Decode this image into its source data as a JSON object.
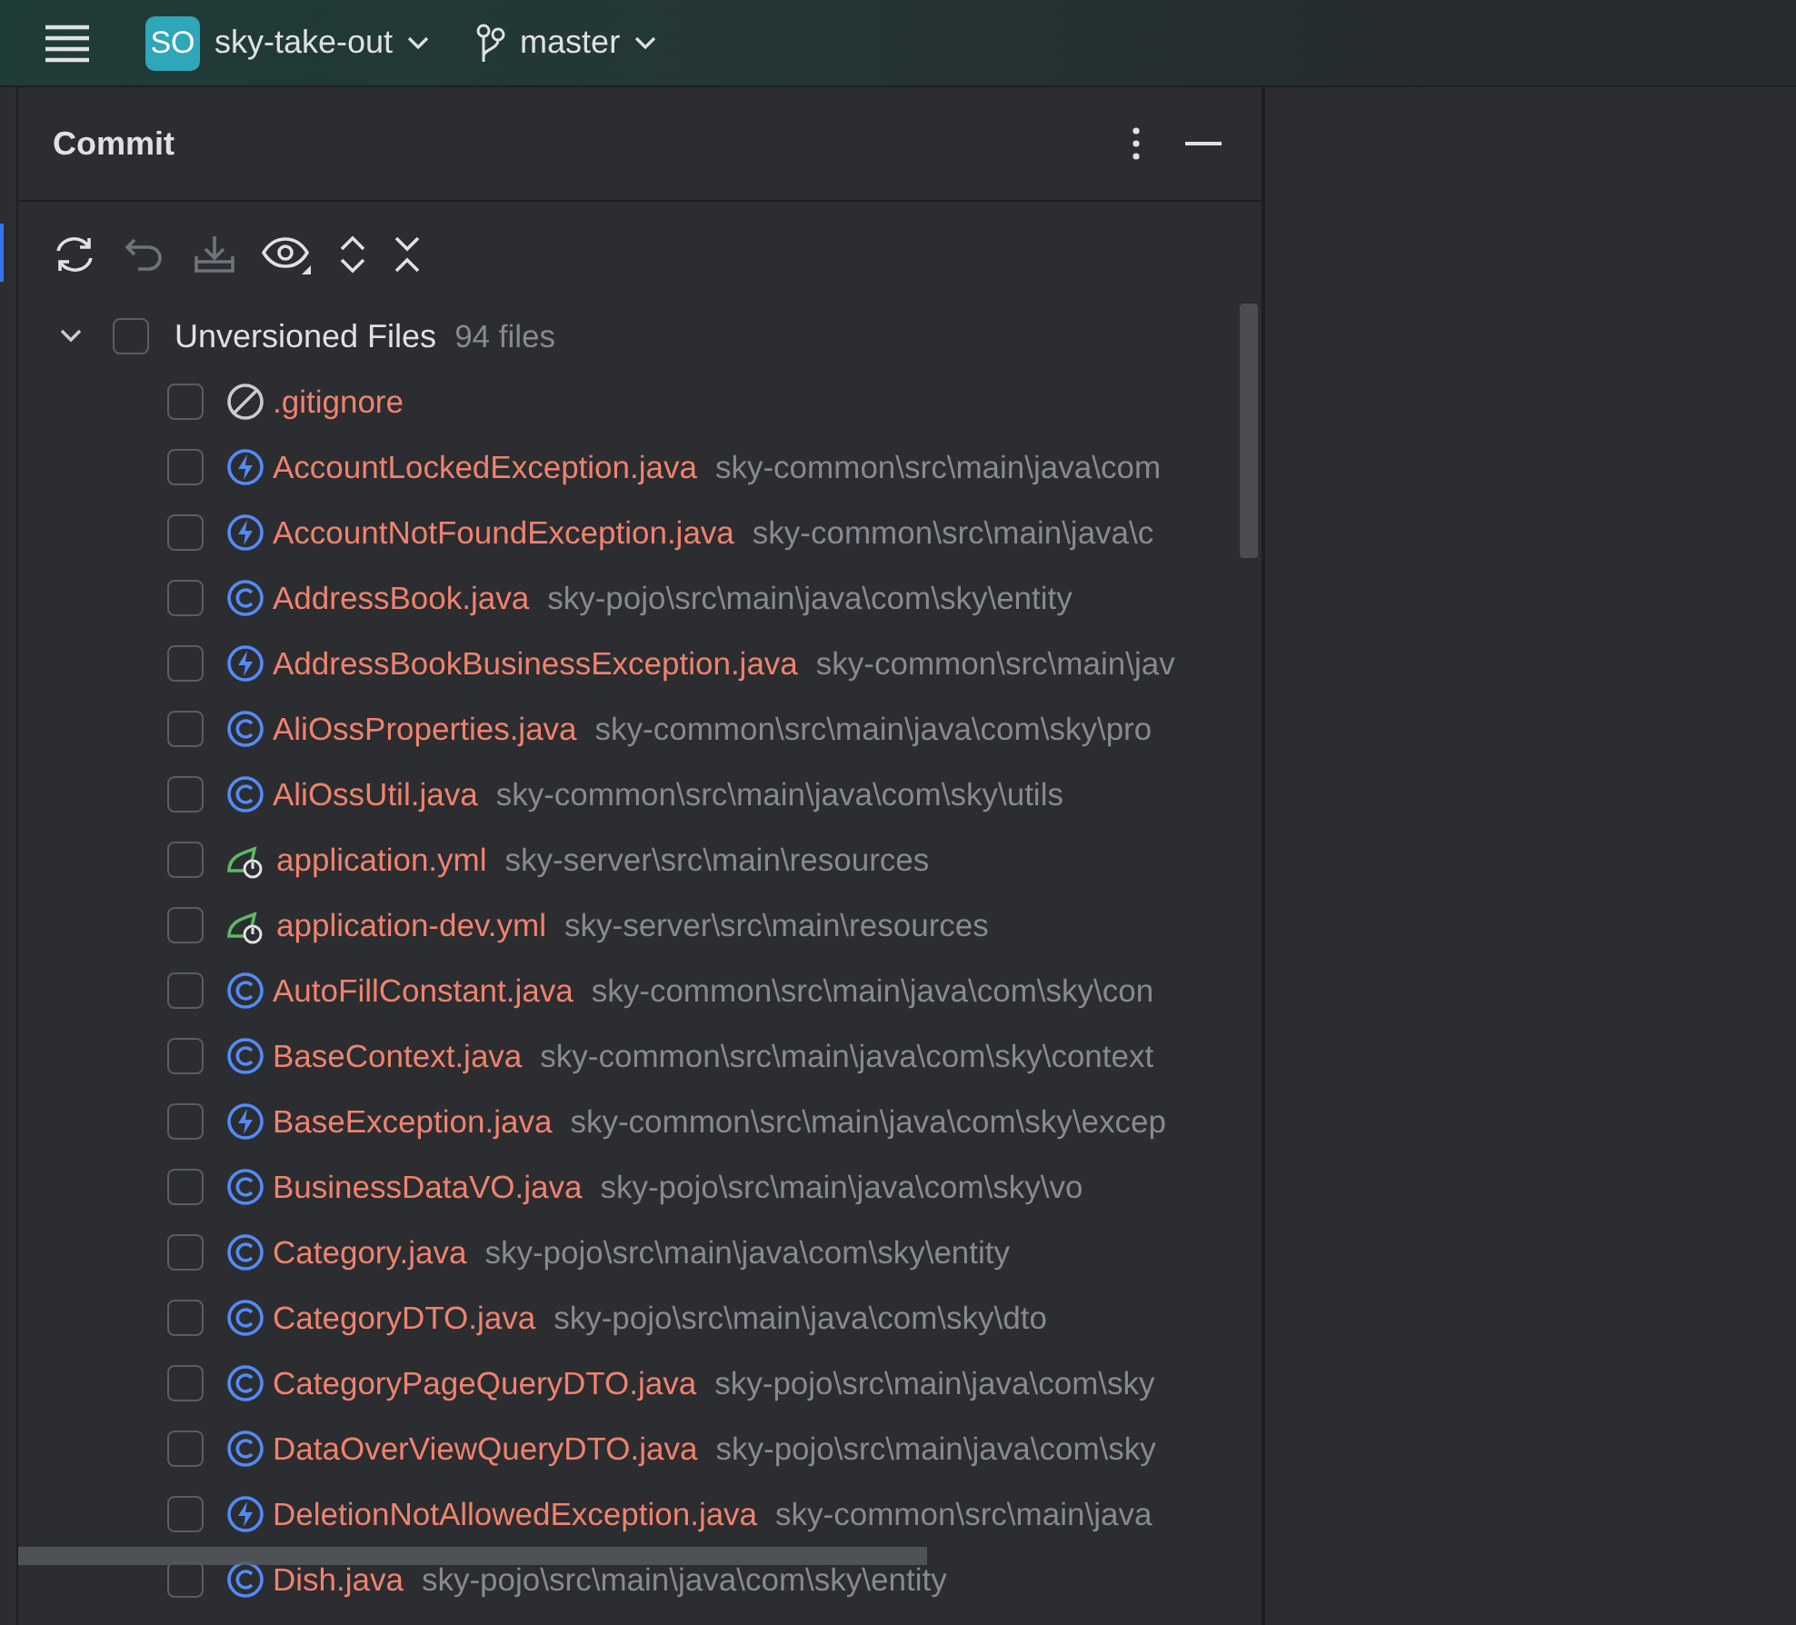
{
  "top_bar": {
    "project_badge": "SO",
    "project": "sky-take-out",
    "branch": "master"
  },
  "panel": {
    "title": "Commit"
  },
  "toolbar": [
    {
      "kind": "refresh",
      "disabled": false
    },
    {
      "kind": "rollback",
      "disabled": true
    },
    {
      "kind": "shelve",
      "disabled": true
    },
    {
      "kind": "view",
      "disabled": false
    },
    {
      "kind": "expand",
      "disabled": false
    },
    {
      "kind": "collapse",
      "disabled": false
    }
  ],
  "group": {
    "label": "Unversioned Files",
    "count": "94 files",
    "expanded": true,
    "checked": false,
    "files": [
      {
        "kind": "ignored",
        "name": ".gitignore",
        "checked": false
      },
      {
        "kind": "exception",
        "name": "AccountLockedException.java",
        "path": "sky-common\\src\\main\\java\\com",
        "checked": false
      },
      {
        "kind": "exception",
        "name": "AccountNotFoundException.java",
        "path": "sky-common\\src\\main\\java\\c",
        "checked": false
      },
      {
        "kind": "class",
        "name": "AddressBook.java",
        "path": "sky-pojo\\src\\main\\java\\com\\sky\\entity",
        "checked": false
      },
      {
        "kind": "exception",
        "name": "AddressBookBusinessException.java",
        "path": "sky-common\\src\\main\\jav",
        "checked": false
      },
      {
        "kind": "class",
        "name": "AliOssProperties.java",
        "path": "sky-common\\src\\main\\java\\com\\sky\\pro",
        "checked": false
      },
      {
        "kind": "class",
        "name": "AliOssUtil.java",
        "path": "sky-common\\src\\main\\java\\com\\sky\\utils",
        "checked": false
      },
      {
        "kind": "spring",
        "name": "application.yml",
        "path": "sky-server\\src\\main\\resources",
        "checked": false
      },
      {
        "kind": "spring",
        "name": "application-dev.yml",
        "path": "sky-server\\src\\main\\resources",
        "checked": false
      },
      {
        "kind": "class",
        "name": "AutoFillConstant.java",
        "path": "sky-common\\src\\main\\java\\com\\sky\\con",
        "checked": false
      },
      {
        "kind": "class",
        "name": "BaseContext.java",
        "path": "sky-common\\src\\main\\java\\com\\sky\\context",
        "checked": false
      },
      {
        "kind": "exception",
        "name": "BaseException.java",
        "path": "sky-common\\src\\main\\java\\com\\sky\\excep",
        "checked": false
      },
      {
        "kind": "class",
        "name": "BusinessDataVO.java",
        "path": "sky-pojo\\src\\main\\java\\com\\sky\\vo",
        "checked": false
      },
      {
        "kind": "class",
        "name": "Category.java",
        "path": "sky-pojo\\src\\main\\java\\com\\sky\\entity",
        "checked": false
      },
      {
        "kind": "class",
        "name": "CategoryDTO.java",
        "path": "sky-pojo\\src\\main\\java\\com\\sky\\dto",
        "checked": false
      },
      {
        "kind": "class",
        "name": "CategoryPageQueryDTO.java",
        "path": "sky-pojo\\src\\main\\java\\com\\sky",
        "checked": false
      },
      {
        "kind": "class",
        "name": "DataOverViewQueryDTO.java",
        "path": "sky-pojo\\src\\main\\java\\com\\sky",
        "checked": false
      },
      {
        "kind": "exception",
        "name": "DeletionNotAllowedException.java",
        "path": "sky-common\\src\\main\\java",
        "checked": false
      },
      {
        "kind": "class",
        "name": "Dish.java",
        "path": "sky-pojo\\src\\main\\java\\com\\sky\\entity",
        "checked": false
      }
    ]
  }
}
